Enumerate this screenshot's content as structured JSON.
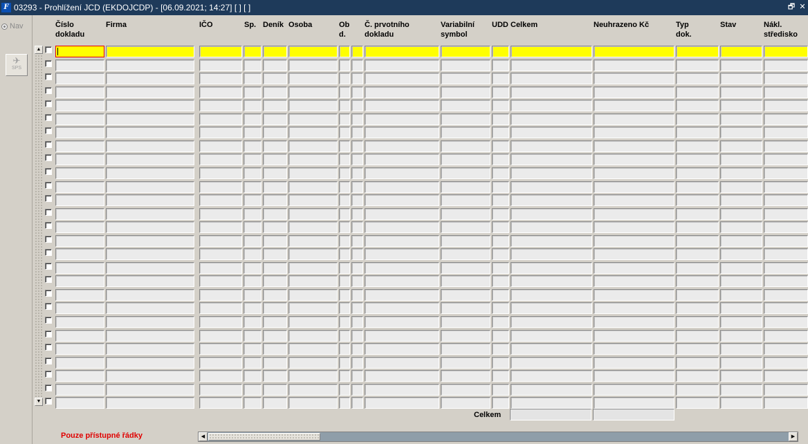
{
  "window": {
    "title": "03293 - Prohlížení JCD (EKDOJCDP) - [06.09.2021; 14:27]  [ ]  [ ]",
    "logo_text": "F",
    "controls": [
      "restore-icon",
      "close-icon"
    ]
  },
  "left_panel": {
    "nav_label": "Nav",
    "sps_label": "SPS",
    "sps_icon": "plane-icon"
  },
  "columns": [
    {
      "key": "cislo_dokladu",
      "label": "Číslo\ndokladu"
    },
    {
      "key": "firma",
      "label": "Firma"
    },
    {
      "key": "ico",
      "label": "IČO"
    },
    {
      "key": "sp",
      "label": "Sp."
    },
    {
      "key": "denik",
      "label": "Deník"
    },
    {
      "key": "osoba",
      "label": "Osoba"
    },
    {
      "key": "obd",
      "label": "Ob\nd."
    },
    {
      "key": "extra",
      "label": ""
    },
    {
      "key": "c_prvotniho_dokladu",
      "label": "Č. prvotního\ndokladu"
    },
    {
      "key": "variabilni_symbol",
      "label": "Variabilní\nsymbol"
    },
    {
      "key": "udd",
      "label": "UDD"
    },
    {
      "key": "celkem",
      "label": "Celkem"
    },
    {
      "key": "neuhrazeno_kc",
      "label": "Neuhrazeno Kč"
    },
    {
      "key": "typ_dok",
      "label": "Typ\ndok."
    },
    {
      "key": "stav",
      "label": "Stav"
    },
    {
      "key": "nakl_strediskova",
      "label": "Nákl.\nstředisko"
    }
  ],
  "grid": {
    "row_count": 27,
    "active_row": 0,
    "rows": []
  },
  "totals": {
    "label": "Celkem",
    "celkem": "",
    "neuhrazeno": ""
  },
  "status": {
    "filter_text": "Pouze přístupné řádky"
  },
  "colors": {
    "titlebar": "#1e3a5a",
    "active_row": "#ffff00",
    "current_cell_border": "#e00000",
    "status_text": "#e00000"
  }
}
